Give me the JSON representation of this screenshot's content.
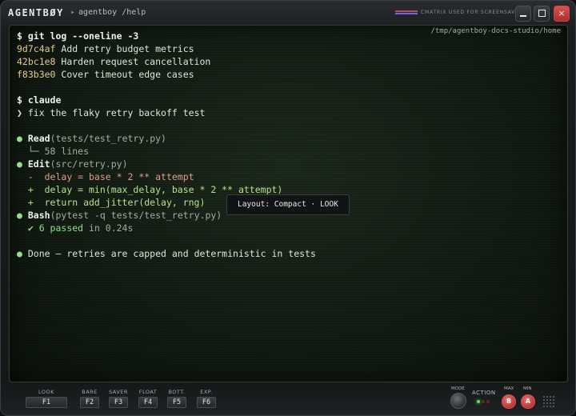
{
  "window": {
    "brand": "AGENTBØY",
    "breadcrumb_sep": "▸",
    "breadcrumb": "agentboy /help",
    "saver_note": "CMATRIX USED FOR SCREENSAVER",
    "controls": {
      "minimize": "minimize",
      "maximize": "maximize",
      "close": "×"
    }
  },
  "terminal": {
    "cwd": "/tmp/agentboy-docs-studio/home",
    "lines": [
      {
        "prompt": "$ ",
        "cmd": "git log --oneline -3"
      },
      {
        "hash": "9d7c4af",
        "msg": " Add retry budget metrics"
      },
      {
        "hash": "42bc1e8",
        "msg": " Harden request cancellation"
      },
      {
        "hash": "f83b3e0",
        "msg": " Cover timeout edge cases"
      },
      {
        "prompt": "$ ",
        "cmd": "claude"
      },
      {
        "chevron": "❯",
        "text": " fix the flaky retry backoff test"
      },
      {
        "bullet": "●",
        "tool": "Read",
        "arg": "(tests/test_retry.py)"
      },
      {
        "tree": "  └─ ",
        "text": "58 lines"
      },
      {
        "bullet": "●",
        "tool": "Edit",
        "arg": "(src/retry.py)"
      },
      {
        "sign": "  -  ",
        "text": "delay = base * 2 ** attempt"
      },
      {
        "sign": "  +  ",
        "text": "delay = min(max_delay, base * 2 ** attempt)"
      },
      {
        "sign": "  +  ",
        "text": "return add_jitter(delay, rng)"
      },
      {
        "bullet": "●",
        "tool": "Bash",
        "arg": "(pytest -q tests/test_retry.py)"
      },
      {
        "check": "  ✔ ",
        "passed": "6 passed",
        "time": " in 0.24s"
      },
      {
        "bullet": "●",
        "text": " Done — retries are capped and deterministic in tests"
      }
    ],
    "tooltip": "Layout: Compact · LOOK"
  },
  "bottombar": {
    "keys": [
      {
        "label": "LOOK",
        "key": "F1"
      },
      {
        "label": "BARE",
        "key": "F2"
      },
      {
        "label": "SAVER",
        "key": "F3"
      },
      {
        "label": "FLOAT",
        "key": "F4"
      },
      {
        "label": "BOTT.",
        "key": "F5"
      },
      {
        "label": "EXP.",
        "key": "F6"
      }
    ],
    "mode_label": "MODE",
    "action_label": "ACTION",
    "max_label": "MAX",
    "min_label": "MIN",
    "btn_b": "B",
    "btn_a": "A",
    "leds": [
      "on",
      "off",
      "off"
    ]
  },
  "colors": {
    "hash": "#e7c98a",
    "bullet": "#8fe08a",
    "deletion": "#e59a8a",
    "addition": "#b6e38a",
    "close_button": "#d9534f"
  }
}
